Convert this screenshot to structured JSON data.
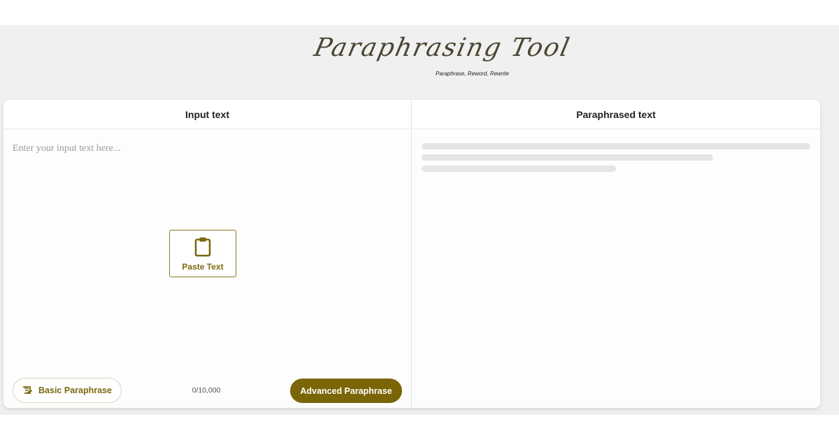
{
  "header": {
    "logo_title": "Paraphrasing Tool",
    "tagline": "Paraphrase, Reword, Rewrite"
  },
  "input_pane": {
    "title": "Input text",
    "placeholder": "Enter your input text here...",
    "paste_label": "Paste Text",
    "paste_icon": "clipboard-icon",
    "basic_label": "Basic Paraphrase",
    "basic_icon": "scroll-icon",
    "counter": "0/10,000",
    "advanced_label": "Advanced Paraphrase"
  },
  "output_pane": {
    "title": "Paraphrased text"
  },
  "colors": {
    "accent": "#7a6507",
    "accent_text": "#7a6a10",
    "background_band": "#f1f0f0",
    "skeleton": "#e5e4e6"
  }
}
